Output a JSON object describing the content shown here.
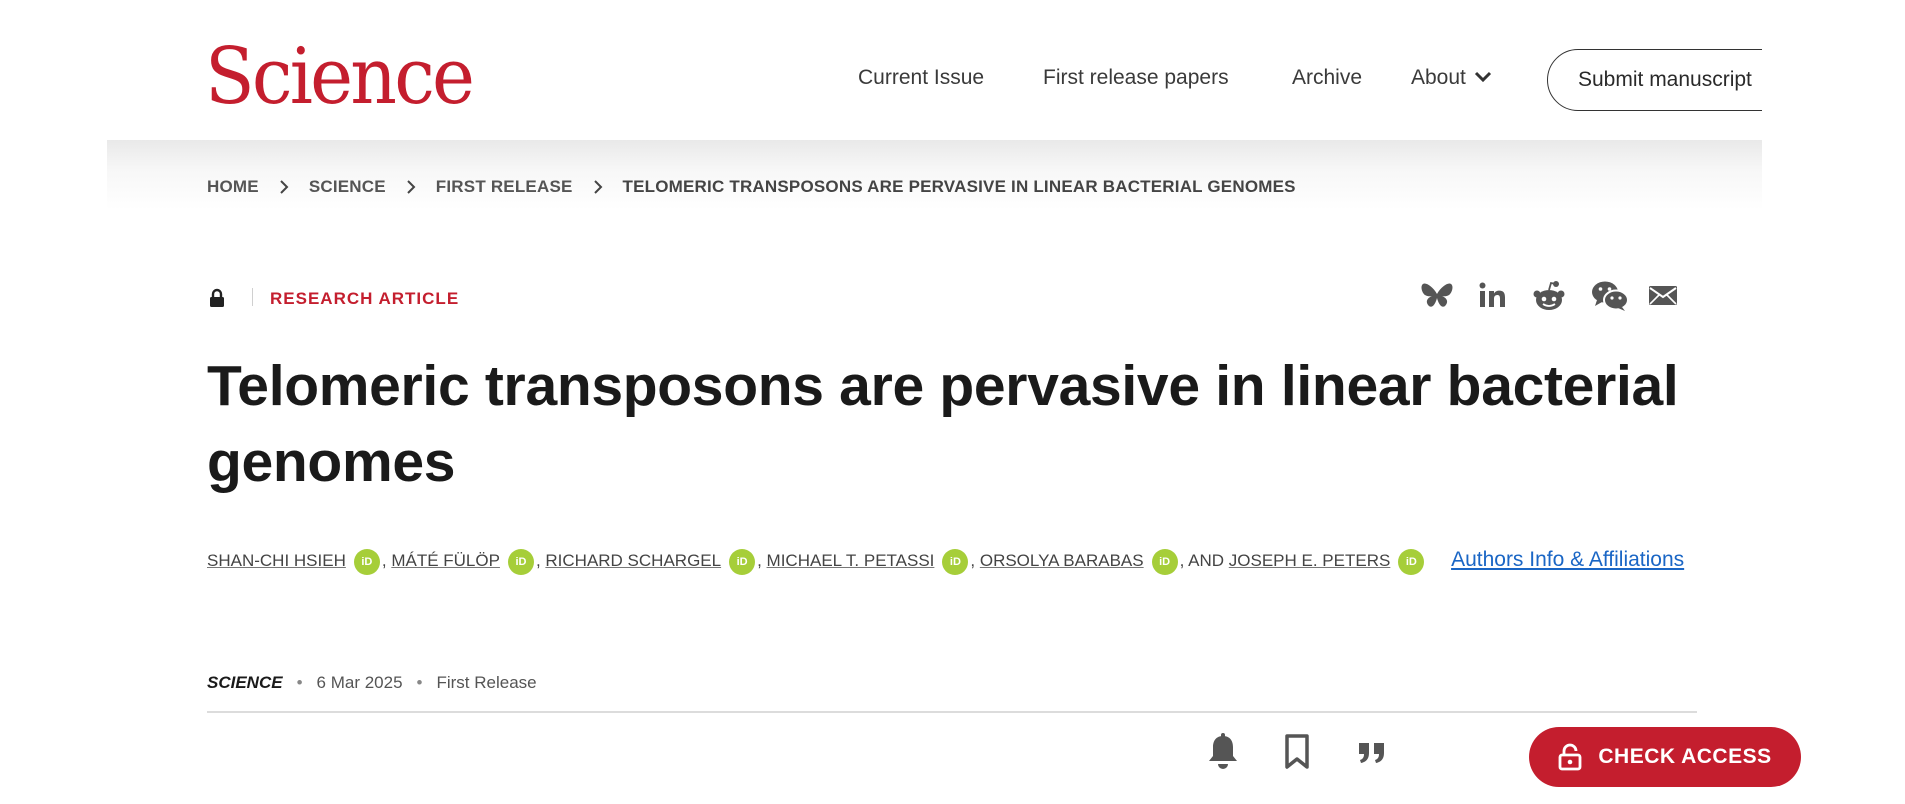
{
  "header": {
    "logo": "Science",
    "nav": [
      {
        "label": "Current Issue"
      },
      {
        "label": "First release papers"
      },
      {
        "label": "Archive"
      },
      {
        "label": "About"
      }
    ],
    "submit_label": "Submit manuscript"
  },
  "breadcrumb": [
    "HOME",
    "SCIENCE",
    "FIRST RELEASE",
    "TELOMERIC TRANSPOSONS ARE PERVASIVE IN LINEAR BACTERIAL GENOMES"
  ],
  "article": {
    "type": "RESEARCH ARTICLE",
    "title": "Telomeric transposons are pervasive in linear bacterial genomes",
    "authors": [
      "SHAN-CHI HSIEH",
      "MÁTÉ FÜLÖP",
      "RICHARD SCHARGEL",
      "MICHAEL T. PETASSI",
      "ORSOLYA BARABAS",
      "JOSEPH E. PETERS"
    ],
    "orcid_label": "iD",
    "and_label": "AND",
    "authors_info_label": "Authors Info & Affiliations",
    "journal": "SCIENCE",
    "date": "6 Mar 2025",
    "section": "First Release"
  },
  "share_icons": [
    "bluesky-icon",
    "linkedin-icon",
    "reddit-icon",
    "wechat-icon",
    "email-icon"
  ],
  "actions": {
    "check_access_label": "CHECK ACCESS"
  },
  "colors": {
    "brand_red": "#c41e2e",
    "orcid_green": "#a6ce39",
    "link_blue": "#1a66c5"
  }
}
